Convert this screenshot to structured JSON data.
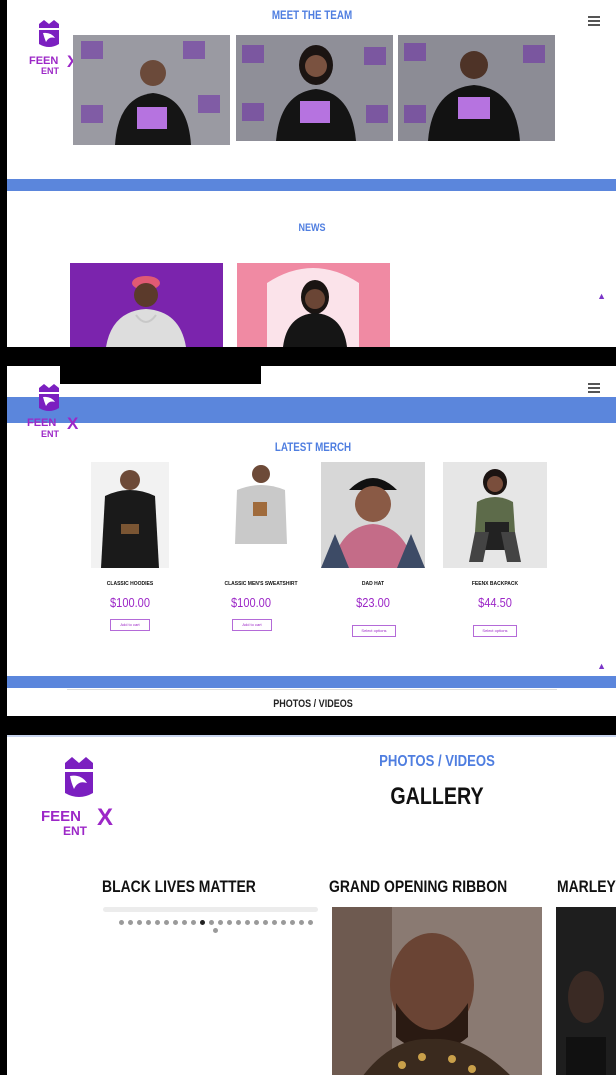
{
  "brand": {
    "logo_top": "FEEN",
    "logo_x": "X",
    "logo_bottom": "ENT"
  },
  "panel1": {
    "section_title": "MEET THE TEAM",
    "news_title": "NEWS"
  },
  "panel2": {
    "section_title": "LATEST MERCH",
    "next_section": "PHOTOS / VIDEOS",
    "products": [
      {
        "name": "CLASSIC HOODIES",
        "price": "$100.00",
        "action": "Add to cart"
      },
      {
        "name": "CLASSIC MEN'S SWEATSHIRT",
        "price": "$100.00",
        "action": "Add to cart"
      },
      {
        "name": "DAD HAT",
        "price": "$23.00",
        "action": "Select options"
      },
      {
        "name": "FEENX BACKPACK",
        "price": "$44.50",
        "action": "Select options"
      }
    ]
  },
  "panel3": {
    "section_title": "PHOTOS / VIDEOS",
    "gallery_title": "GALLERY",
    "albums": [
      "BLACK LIVES MATTER",
      "GRAND OPENING RIBBON",
      "MARLEY"
    ],
    "dots_total": 23,
    "dots_active": 9
  },
  "icons": {
    "menu": "hamburger-menu-icon",
    "scroll_top": "chevron-up-icon"
  },
  "colors": {
    "accent_blue": "#5b86dc",
    "brand_purple": "#9c27c7",
    "title_blue": "#4f7ee0"
  }
}
